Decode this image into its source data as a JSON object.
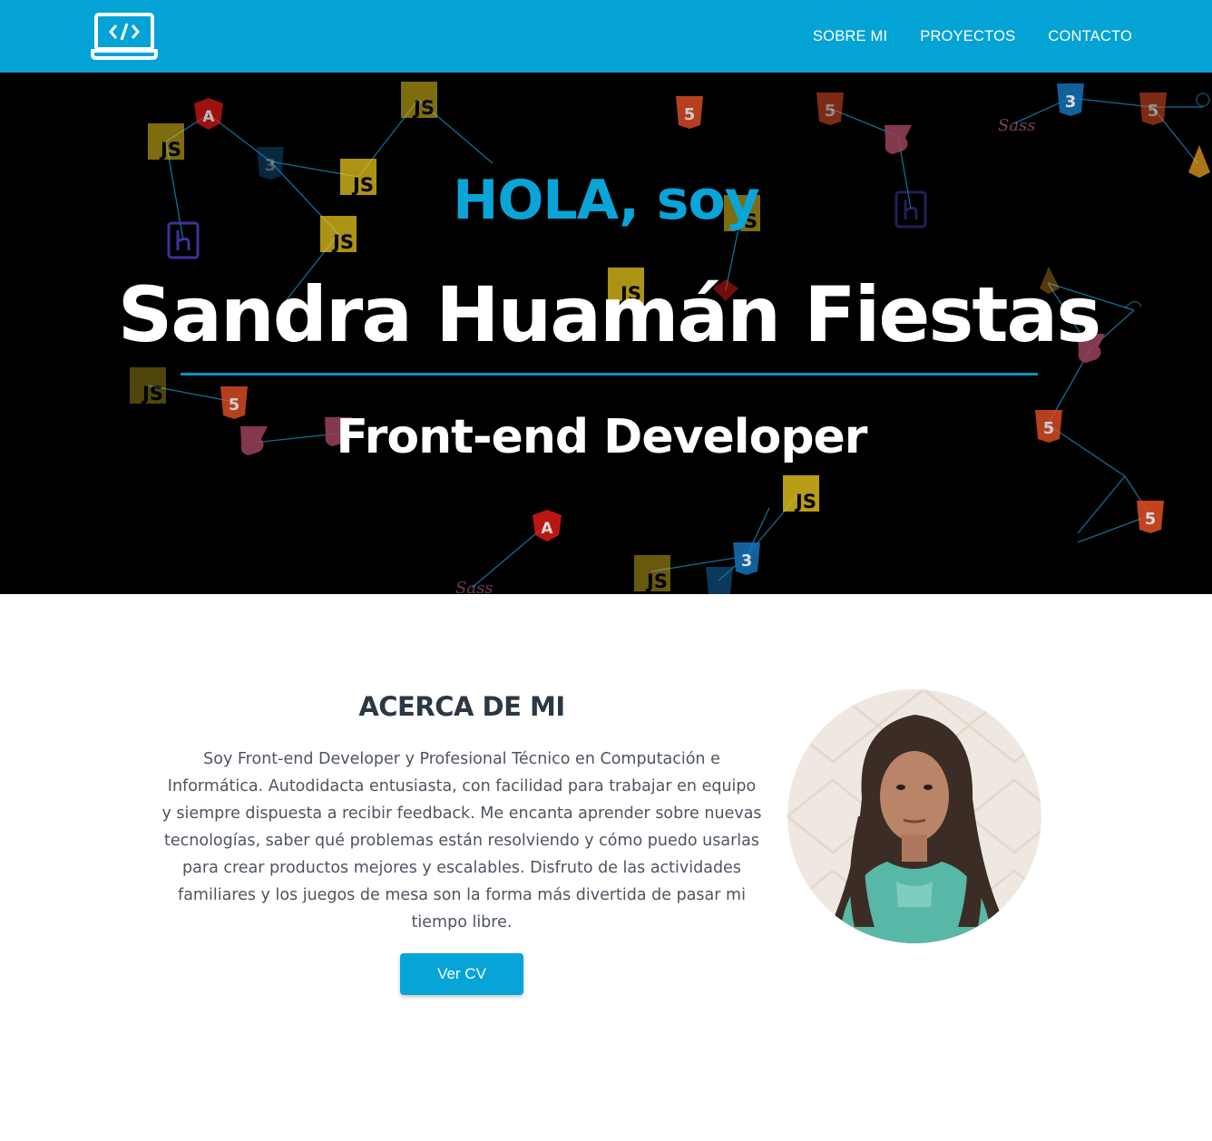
{
  "navbar": {
    "logo_icon": "laptop-code-icon",
    "links": [
      "SOBRE MI",
      "PROYECTOS",
      "CONTACTO"
    ],
    "background": "#04a3d6"
  },
  "hero": {
    "greeting": "HOLA, soy",
    "name": "Sandra Huamán Fiestas",
    "role": "Front-end Developer",
    "background_icons": [
      "js-icon",
      "angular-icon",
      "html5-icon",
      "css3-icon",
      "heroku-icon",
      "jest-icon",
      "sass-icon",
      "firebase-icon",
      "webpack-icon"
    ],
    "accent": "#0aa4d8"
  },
  "about": {
    "title": "ACERCA DE MI",
    "text": "Soy Front-end Developer y Profesional Técnico en Computación e Informática. Autodidacta entusiasta, con facilidad para trabajar en equipo y siempre dispuesta a recibir feedback. Me encanta aprender sobre nuevas tecnologías, saber qué problemas están resolviendo y cómo puedo usarlas para crear productos mejores y escalables. Disfruto de las actividades familiares y los juegos de mesa son la forma más divertida de pasar mi tiempo libre.",
    "button_label": "Ver CV",
    "photo": "profile-photo"
  }
}
